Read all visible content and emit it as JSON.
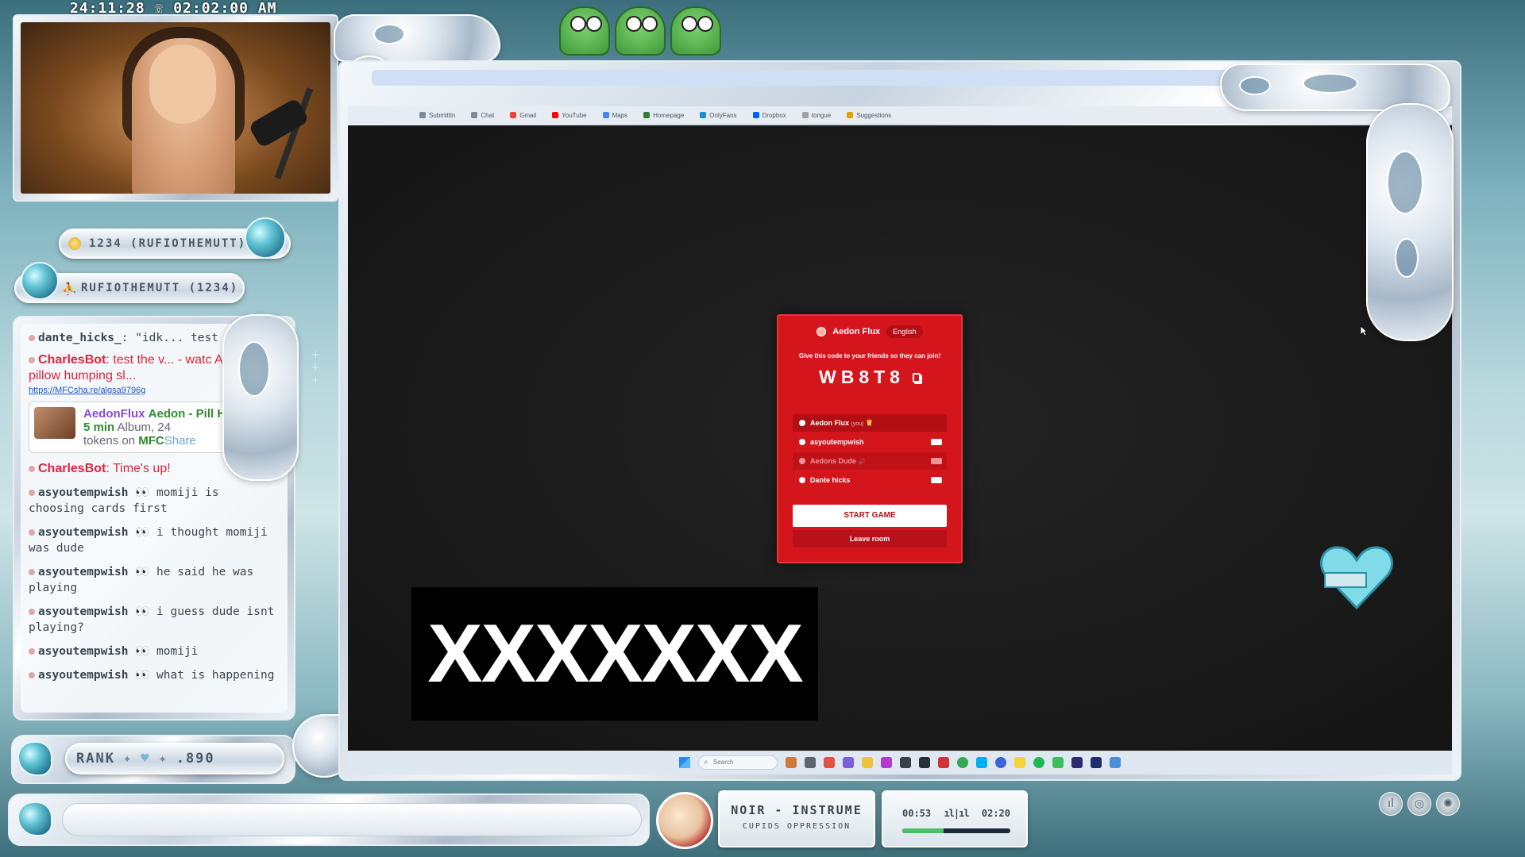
{
  "overlay": {
    "timestamp": "24:11:28 ☏ 02:02:00 AM",
    "follower_pill": "1234 (RUFIOTHEMUTT)",
    "sub_pill": "RUFIOTHEMUTT (1234)",
    "rank": {
      "label": "RANK",
      "value": ".890"
    },
    "music": {
      "title": "NOIR - INSTRUME",
      "artist": "CUPIDS OPPRESSION",
      "elapsed": "00:53",
      "total": "02:20",
      "progress": 0.38,
      "eq": "ıl|ıl"
    }
  },
  "chat": {
    "messages": [
      {
        "type": "user",
        "user": "dante_hicks_",
        "text": ": \"idk... test"
      },
      {
        "type": "bot",
        "user": "CharlesBot",
        "text": ": test the v... - watc Aedon's pillow humping sl...",
        "link": "https://MFCsha.re/algsa9796g"
      },
      {
        "type": "card",
        "user": "AedonFlux",
        "title": "Aedon - Pill Hump for 5 min",
        "meta": "Album, 24",
        "tokens": "tokens on",
        "brand": "MFC",
        "brand2": "Share"
      },
      {
        "type": "bot",
        "user": "CharlesBot",
        "text": ": Time's up!"
      },
      {
        "type": "user",
        "user": "asyoutempwish",
        "text": "momiji is choosing cards first"
      },
      {
        "type": "user",
        "user": "asyoutempwish",
        "text": "i thought momiji was dude"
      },
      {
        "type": "user",
        "user": "asyoutempwish",
        "text": "he said he was playing"
      },
      {
        "type": "user",
        "user": "asyoutempwish",
        "text": "i guess dude isnt playing?"
      },
      {
        "type": "user",
        "user": "asyoutempwish",
        "text": "momiji"
      },
      {
        "type": "user",
        "user": "asyoutempwish",
        "text": "what is happening"
      }
    ]
  },
  "browser": {
    "bookmarks": [
      "Submittin",
      "Chat",
      "Gmail",
      "YouTube",
      "Maps",
      "Homepage",
      "OnlyFans",
      "Dropbox",
      "tongue",
      "Suggestions"
    ],
    "bookmark_colors": [
      "#7c8a99",
      "#7c8a99",
      "#ea4335",
      "#ff0000",
      "#4285f4",
      "#2e7d32",
      "#1a8cd8",
      "#0061fe",
      "#a0a0a0",
      "#e0a000"
    ],
    "taskbar_search": "Search"
  },
  "game": {
    "host": "Aedon Flux",
    "language": "English",
    "share_hint": "Give this code to your friends so they can join!",
    "room_code": "WB8T8",
    "players": [
      {
        "name": "Aedon Flux",
        "tag": "(you)",
        "role": "host"
      },
      {
        "name": "asyoutempwish",
        "tag": "",
        "role": "player"
      },
      {
        "name": "Aedons Dude",
        "tag": "🔊",
        "role": "player"
      },
      {
        "name": "Dante hicks",
        "tag": "",
        "role": "player"
      }
    ],
    "start_label": "START GAME",
    "leave_label": "Leave room"
  },
  "censor_text": "XXXXXXX"
}
